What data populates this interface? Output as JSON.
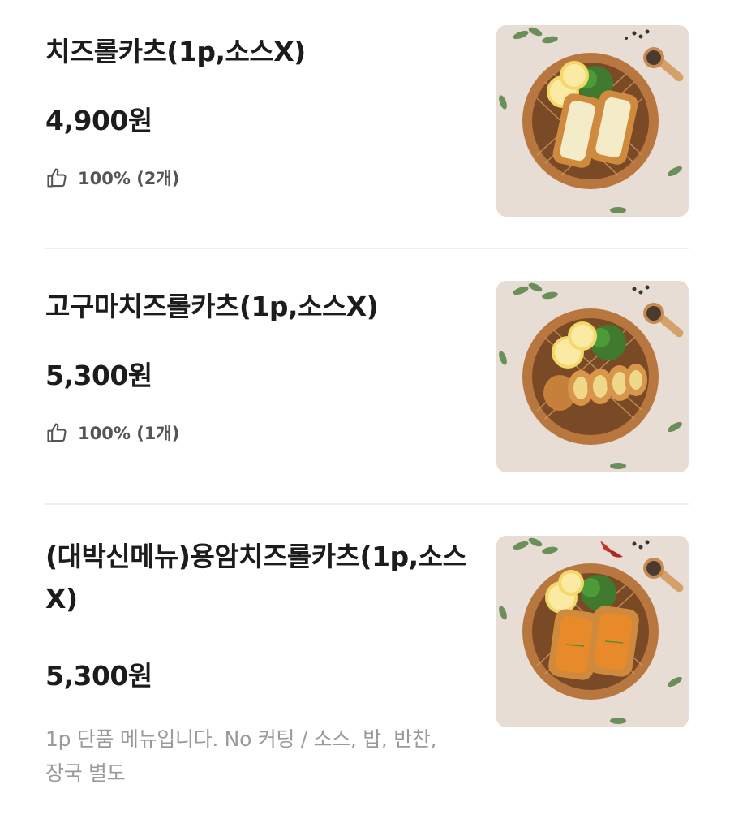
{
  "menu": {
    "items": [
      {
        "name": "치즈롤카츠(1p,소스X)",
        "price": "4,900원",
        "rating": "100% (2개)",
        "description": "",
        "photo_icon": "cheese-roll-katsu-photo"
      },
      {
        "name": "고구마치즈롤카츠(1p,소스X)",
        "price": "5,300원",
        "rating": "100% (1개)",
        "description": "",
        "photo_icon": "sweet-potato-cheese-roll-katsu-photo"
      },
      {
        "name": "(대박신메뉴)용암치즈롤카츠(1p,소스X)",
        "price": "5,300원",
        "rating": "",
        "description": "1p 단품 메뉴입니다. No 커팅 / 소스, 밥, 반찬, 장국 별도",
        "photo_icon": "lava-cheese-roll-katsu-photo"
      }
    ]
  },
  "colors": {
    "title_text": "#1c1c1c",
    "rating_text": "#555555",
    "desc_text": "#9a9a9a",
    "divider": "#ececec",
    "photo_bg": "#e7ddd5",
    "board_wood": "#b8773f",
    "katsu_crust": "#cf8a3e",
    "cheese_fill": "#f4ecc8",
    "lava_fill": "#e88a2a"
  },
  "icons": {
    "thumb": "thumbs-up-icon"
  }
}
